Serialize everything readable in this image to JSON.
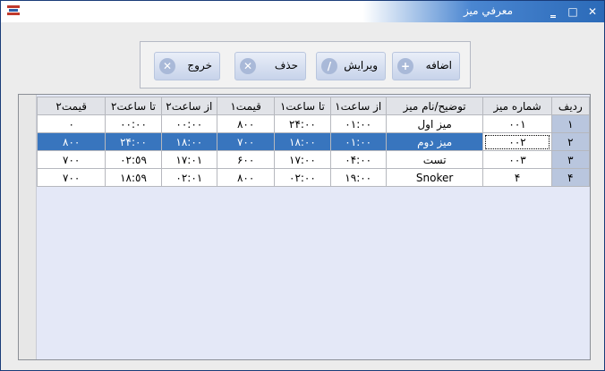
{
  "window": {
    "title": "معرفي ميز"
  },
  "toolbar": {
    "add": "اضافه",
    "edit": "ويرايش",
    "delete": "حذف",
    "exit": "خروج"
  },
  "grid": {
    "headers": [
      "قيمت٢",
      "تا ساعت٢",
      "از ساعت٢",
      "قيمت١",
      "تا ساعت١",
      "از ساعت١",
      "توضيح/نام ميز",
      "شماره ميز",
      "رديف"
    ],
    "rows": [
      [
        "٠",
        "٠٠:٠٠",
        "٠٠:٠٠",
        "٨٠٠",
        "٢۴:٠٠",
        "٠١:٠٠",
        "ميز اول",
        "٠٠١",
        "١"
      ],
      [
        "٨٠٠",
        "٢۴:٠٠",
        "١٨:٠٠",
        "٧٠٠",
        "١٨:٠٠",
        "٠١:٠٠",
        "ميز دوم",
        "٠٠٢",
        "٢"
      ],
      [
        "٧٠٠",
        "٠٢:٥٩",
        "١٧:٠١",
        "۶٠٠",
        "١٧:٠٠",
        "٠۴:٠٠",
        "تست",
        "٠٠٣",
        "٣"
      ],
      [
        "٧٠٠",
        "١٨:٥٩",
        "٠٢:٠١",
        "٨٠٠",
        "٠٢:٠٠",
        "١٩:٠٠",
        "Snoker",
        "۴",
        "۴"
      ]
    ],
    "selected_row": 1
  }
}
